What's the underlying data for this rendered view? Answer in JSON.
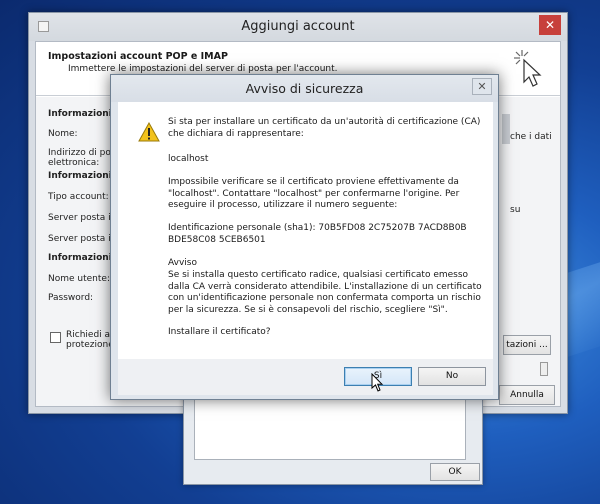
{
  "back_window": {
    "title": "Aggiungi account",
    "close_glyph": "✕",
    "header_title": "Impostazioni account POP e IMAP",
    "header_subtitle": "Immettere le impostazioni del server di posta per l'account.",
    "left_labels": [
      "Informazioni ute",
      "Nome:",
      "Indirizzo di post",
      "elettronica:",
      "Informazioni se",
      "Tipo account:",
      "Server posta in a",
      "Server posta in u",
      "Informazioni acc",
      "Nome utente:",
      "Password:"
    ],
    "checkbox_label_line1": "Richiedi acce",
    "checkbox_label_line2": "protezione (S",
    "right_fragment_1": "che i dati",
    "right_fragment_2": "su",
    "settings_button": "tazioni ...",
    "cancel_button": "Annulla"
  },
  "lower_window": {
    "ok_button": "OK"
  },
  "security_dialog": {
    "title": "Avviso di sicurezza",
    "close_glyph": "✕",
    "warning_icon": "warning-triangle-icon",
    "intro": "Si sta per installare un certificato da un'autorità di certificazione (CA) che dichiara di rappresentare:",
    "host": "localhost",
    "verify_text": "Impossibile verificare se il certificato proviene effettivamente da \"localhost\". Contattare \"localhost\" per confermarne l'origine. Per eseguire il processo, utilizzare il numero seguente:",
    "thumbprint_line1": "Identificazione personale (sha1): 70B5FD08 2C75207B 7ACD8B0B",
    "thumbprint_line2": "BDE58C08 5CEB6501",
    "warning_heading": "Avviso",
    "warning_text": "Se si installa questo certificato radice, qualsiasi certificato emesso dalla CA verrà considerato attendibile. L'installazione di un certificato con un'identificazione personale non confermata comporta un rischio per la sicurezza. Se si è consapevoli del rischio, scegliere \"Sì\".",
    "question": "Installare il certificato?",
    "yes_button": "Sì",
    "no_button": "No"
  }
}
